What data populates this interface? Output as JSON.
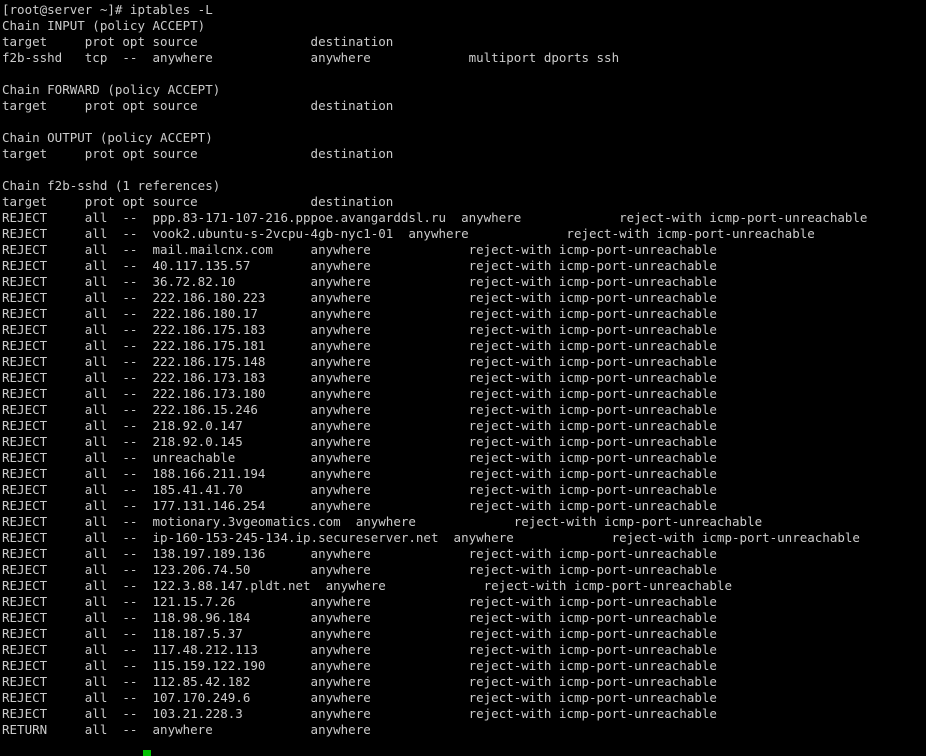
{
  "terminal": {
    "title": "iptables -L",
    "colors": {
      "background": "#000000",
      "foreground": "#cccccc",
      "cursor": "#00c000"
    },
    "char_width": 7.04,
    "line_height": 16,
    "prompt": "[root@server ~]#",
    "command": "iptables -L",
    "prompt_line": "[root@server ~]# iptables -L",
    "cursor": {
      "visible": true,
      "shape": "block",
      "color": "#00c000",
      "column": 20,
      "row": 46
    }
  },
  "columns": {
    "target": "target",
    "prot": "prot",
    "opt": "opt",
    "source": "source",
    "destination": "destination",
    "header_line": "target     prot opt source               destination"
  },
  "chains": [
    {
      "name": "INPUT",
      "policy": "ACCEPT",
      "header": "Chain INPUT (policy ACCEPT)",
      "rules": [
        {
          "target": "f2b-sshd",
          "prot": "tcp",
          "opt": "--",
          "source": "anywhere",
          "destination": "anywhere",
          "extra": "multiport dports ssh",
          "line": "f2b-sshd   tcp  --  anywhere             anywhere             multiport dports ssh"
        }
      ]
    },
    {
      "name": "FORWARD",
      "policy": "ACCEPT",
      "header": "Chain FORWARD (policy ACCEPT)",
      "rules": []
    },
    {
      "name": "OUTPUT",
      "policy": "ACCEPT",
      "header": "Chain OUTPUT (policy ACCEPT)",
      "rules": []
    },
    {
      "name": "f2b-sshd",
      "references": 1,
      "header": "Chain f2b-sshd (1 references)",
      "rules": [
        {
          "target": "REJECT",
          "prot": "all",
          "opt": "--",
          "source": "ppp.83-171-107-216.pppoe.avangarddsl.ru",
          "destination": "anywhere",
          "extra": "reject-with icmp-port-unreachable"
        },
        {
          "target": "REJECT",
          "prot": "all",
          "opt": "--",
          "source": "vook2.ubuntu-s-2vcpu-4gb-nyc1-01",
          "destination": "anywhere",
          "extra": "reject-with icmp-port-unreachable"
        },
        {
          "target": "REJECT",
          "prot": "all",
          "opt": "--",
          "source": "mail.mailcnx.com",
          "destination": "anywhere",
          "extra": "reject-with icmp-port-unreachable"
        },
        {
          "target": "REJECT",
          "prot": "all",
          "opt": "--",
          "source": "40.117.135.57",
          "destination": "anywhere",
          "extra": "reject-with icmp-port-unreachable"
        },
        {
          "target": "REJECT",
          "prot": "all",
          "opt": "--",
          "source": "36.72.82.10",
          "destination": "anywhere",
          "extra": "reject-with icmp-port-unreachable"
        },
        {
          "target": "REJECT",
          "prot": "all",
          "opt": "--",
          "source": "222.186.180.223",
          "destination": "anywhere",
          "extra": "reject-with icmp-port-unreachable"
        },
        {
          "target": "REJECT",
          "prot": "all",
          "opt": "--",
          "source": "222.186.180.17",
          "destination": "anywhere",
          "extra": "reject-with icmp-port-unreachable"
        },
        {
          "target": "REJECT",
          "prot": "all",
          "opt": "--",
          "source": "222.186.175.183",
          "destination": "anywhere",
          "extra": "reject-with icmp-port-unreachable"
        },
        {
          "target": "REJECT",
          "prot": "all",
          "opt": "--",
          "source": "222.186.175.181",
          "destination": "anywhere",
          "extra": "reject-with icmp-port-unreachable"
        },
        {
          "target": "REJECT",
          "prot": "all",
          "opt": "--",
          "source": "222.186.175.148",
          "destination": "anywhere",
          "extra": "reject-with icmp-port-unreachable"
        },
        {
          "target": "REJECT",
          "prot": "all",
          "opt": "--",
          "source": "222.186.173.183",
          "destination": "anywhere",
          "extra": "reject-with icmp-port-unreachable"
        },
        {
          "target": "REJECT",
          "prot": "all",
          "opt": "--",
          "source": "222.186.173.180",
          "destination": "anywhere",
          "extra": "reject-with icmp-port-unreachable"
        },
        {
          "target": "REJECT",
          "prot": "all",
          "opt": "--",
          "source": "222.186.15.246",
          "destination": "anywhere",
          "extra": "reject-with icmp-port-unreachable"
        },
        {
          "target": "REJECT",
          "prot": "all",
          "opt": "--",
          "source": "218.92.0.147",
          "destination": "anywhere",
          "extra": "reject-with icmp-port-unreachable"
        },
        {
          "target": "REJECT",
          "prot": "all",
          "opt": "--",
          "source": "218.92.0.145",
          "destination": "anywhere",
          "extra": "reject-with icmp-port-unreachable"
        },
        {
          "target": "REJECT",
          "prot": "all",
          "opt": "--",
          "source": "unreachable",
          "destination": "anywhere",
          "extra": "reject-with icmp-port-unreachable"
        },
        {
          "target": "REJECT",
          "prot": "all",
          "opt": "--",
          "source": "188.166.211.194",
          "destination": "anywhere",
          "extra": "reject-with icmp-port-unreachable"
        },
        {
          "target": "REJECT",
          "prot": "all",
          "opt": "--",
          "source": "185.41.41.70",
          "destination": "anywhere",
          "extra": "reject-with icmp-port-unreachable"
        },
        {
          "target": "REJECT",
          "prot": "all",
          "opt": "--",
          "source": "177.131.146.254",
          "destination": "anywhere",
          "extra": "reject-with icmp-port-unreachable"
        },
        {
          "target": "REJECT",
          "prot": "all",
          "opt": "--",
          "source": "motionary.3vgeomatics.com",
          "destination": "anywhere",
          "extra": "reject-with icmp-port-unreachable"
        },
        {
          "target": "REJECT",
          "prot": "all",
          "opt": "--",
          "source": "ip-160-153-245-134.ip.secureserver.net",
          "destination": "anywhere",
          "extra": "reject-with icmp-port-unreachable"
        },
        {
          "target": "REJECT",
          "prot": "all",
          "opt": "--",
          "source": "138.197.189.136",
          "destination": "anywhere",
          "extra": "reject-with icmp-port-unreachable"
        },
        {
          "target": "REJECT",
          "prot": "all",
          "opt": "--",
          "source": "123.206.74.50",
          "destination": "anywhere",
          "extra": "reject-with icmp-port-unreachable"
        },
        {
          "target": "REJECT",
          "prot": "all",
          "opt": "--",
          "source": "122.3.88.147.pldt.net",
          "destination": "anywhere",
          "extra": "reject-with icmp-port-unreachable"
        },
        {
          "target": "REJECT",
          "prot": "all",
          "opt": "--",
          "source": "121.15.7.26",
          "destination": "anywhere",
          "extra": "reject-with icmp-port-unreachable"
        },
        {
          "target": "REJECT",
          "prot": "all",
          "opt": "--",
          "source": "118.98.96.184",
          "destination": "anywhere",
          "extra": "reject-with icmp-port-unreachable"
        },
        {
          "target": "REJECT",
          "prot": "all",
          "opt": "--",
          "source": "118.187.5.37",
          "destination": "anywhere",
          "extra": "reject-with icmp-port-unreachable"
        },
        {
          "target": "REJECT",
          "prot": "all",
          "opt": "--",
          "source": "117.48.212.113",
          "destination": "anywhere",
          "extra": "reject-with icmp-port-unreachable"
        },
        {
          "target": "REJECT",
          "prot": "all",
          "opt": "--",
          "source": "115.159.122.190",
          "destination": "anywhere",
          "extra": "reject-with icmp-port-unreachable"
        },
        {
          "target": "REJECT",
          "prot": "all",
          "opt": "--",
          "source": "112.85.42.182",
          "destination": "anywhere",
          "extra": "reject-with icmp-port-unreachable"
        },
        {
          "target": "REJECT",
          "prot": "all",
          "opt": "--",
          "source": "107.170.249.6",
          "destination": "anywhere",
          "extra": "reject-with icmp-port-unreachable"
        },
        {
          "target": "REJECT",
          "prot": "all",
          "opt": "--",
          "source": "103.21.228.3",
          "destination": "anywhere",
          "extra": "reject-with icmp-port-unreachable"
        },
        {
          "target": "RETURN",
          "prot": "all",
          "opt": "--",
          "source": "anywhere",
          "destination": "anywhere",
          "extra": ""
        }
      ]
    }
  ],
  "screen_lines": [
    "[root@server ~]# iptables -L",
    "Chain INPUT (policy ACCEPT)",
    "target     prot opt source               destination         ",
    "f2b-sshd   tcp  --  anywhere             anywhere             multiport dports ssh",
    "",
    "Chain FORWARD (policy ACCEPT)",
    "target     prot opt source               destination         ",
    "",
    "Chain OUTPUT (policy ACCEPT)",
    "target     prot opt source               destination         ",
    "",
    "Chain f2b-sshd (1 references)",
    "target     prot opt source               destination         ",
    "REJECT     all  --  ppp.83-171-107-216.pppoe.avangarddsl.ru  anywhere             reject-with icmp-port-unreachable",
    "REJECT     all  --  vook2.ubuntu-s-2vcpu-4gb-nyc1-01  anywhere             reject-with icmp-port-unreachable",
    "REJECT     all  --  mail.mailcnx.com     anywhere             reject-with icmp-port-unreachable",
    "REJECT     all  --  40.117.135.57        anywhere             reject-with icmp-port-unreachable",
    "REJECT     all  --  36.72.82.10          anywhere             reject-with icmp-port-unreachable",
    "REJECT     all  --  222.186.180.223      anywhere             reject-with icmp-port-unreachable",
    "REJECT     all  --  222.186.180.17       anywhere             reject-with icmp-port-unreachable",
    "REJECT     all  --  222.186.175.183      anywhere             reject-with icmp-port-unreachable",
    "REJECT     all  --  222.186.175.181      anywhere             reject-with icmp-port-unreachable",
    "REJECT     all  --  222.186.175.148      anywhere             reject-with icmp-port-unreachable",
    "REJECT     all  --  222.186.173.183      anywhere             reject-with icmp-port-unreachable",
    "REJECT     all  --  222.186.173.180      anywhere             reject-with icmp-port-unreachable",
    "REJECT     all  --  222.186.15.246       anywhere             reject-with icmp-port-unreachable",
    "REJECT     all  --  218.92.0.147         anywhere             reject-with icmp-port-unreachable",
    "REJECT     all  --  218.92.0.145         anywhere             reject-with icmp-port-unreachable",
    "REJECT     all  --  unreachable          anywhere             reject-with icmp-port-unreachable",
    "REJECT     all  --  188.166.211.194      anywhere             reject-with icmp-port-unreachable",
    "REJECT     all  --  185.41.41.70         anywhere             reject-with icmp-port-unreachable",
    "REJECT     all  --  177.131.146.254      anywhere             reject-with icmp-port-unreachable",
    "REJECT     all  --  motionary.3vgeomatics.com  anywhere             reject-with icmp-port-unreachable",
    "REJECT     all  --  ip-160-153-245-134.ip.secureserver.net  anywhere             reject-with icmp-port-unreachable",
    "REJECT     all  --  138.197.189.136      anywhere             reject-with icmp-port-unreachable",
    "REJECT     all  --  123.206.74.50        anywhere             reject-with icmp-port-unreachable",
    "REJECT     all  --  122.3.88.147.pldt.net  anywhere             reject-with icmp-port-unreachable",
    "REJECT     all  --  121.15.7.26          anywhere             reject-with icmp-port-unreachable",
    "REJECT     all  --  118.98.96.184        anywhere             reject-with icmp-port-unreachable",
    "REJECT     all  --  118.187.5.37         anywhere             reject-with icmp-port-unreachable",
    "REJECT     all  --  117.48.212.113       anywhere             reject-with icmp-port-unreachable",
    "REJECT     all  --  115.159.122.190      anywhere             reject-with icmp-port-unreachable",
    "REJECT     all  --  112.85.42.182        anywhere             reject-with icmp-port-unreachable",
    "REJECT     all  --  107.170.249.6        anywhere             reject-with icmp-port-unreachable",
    "REJECT     all  --  103.21.228.3         anywhere             reject-with icmp-port-unreachable",
    "RETURN     all  --  anywhere             anywhere            "
  ]
}
